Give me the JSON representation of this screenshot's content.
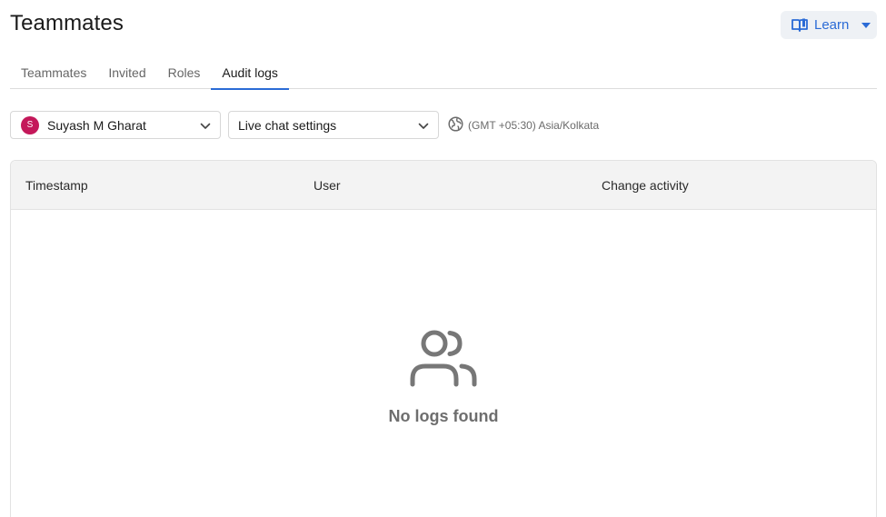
{
  "header": {
    "title": "Teammates",
    "learn_label": "Learn",
    "accent_color": "#2b6bd6"
  },
  "tabs": [
    {
      "label": "Teammates",
      "active": false
    },
    {
      "label": "Invited",
      "active": false
    },
    {
      "label": "Roles",
      "active": false
    },
    {
      "label": "Audit logs",
      "active": true
    }
  ],
  "filters": {
    "user": {
      "avatar_initial": "S",
      "value": "Suyash M Gharat",
      "avatar_color": "#c4185a"
    },
    "area": {
      "value": "Live chat settings"
    },
    "timezone": "(GMT +05:30) Asia/Kolkata"
  },
  "table": {
    "columns": [
      "Timestamp",
      "User",
      "Change activity"
    ],
    "rows": [],
    "empty_message": "No logs found"
  },
  "icons": {
    "learn": "book-icon",
    "timezone": "globe-icon",
    "empty": "users-icon",
    "dropdown": "chevron-down-icon"
  }
}
